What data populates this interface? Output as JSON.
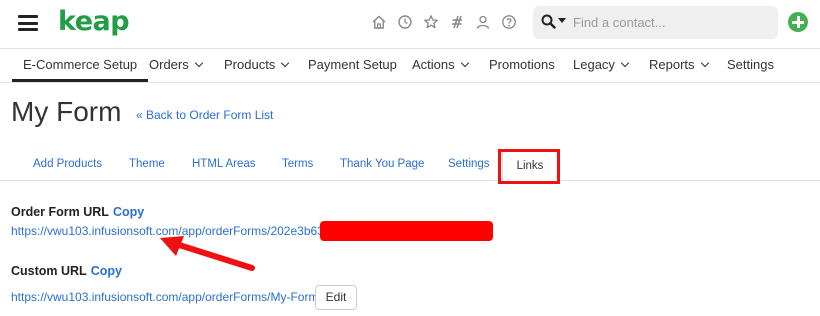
{
  "header": {
    "logo": "keap",
    "nav_icons": [
      "home-icon",
      "clock-icon",
      "star-icon",
      "hashtag-icon",
      "person-icon",
      "help-icon"
    ],
    "search_placeholder": "Find a contact..."
  },
  "menu": {
    "items": [
      {
        "label": "E-Commerce Setup",
        "active": true,
        "dropdown": false
      },
      {
        "label": "Orders",
        "dropdown": true
      },
      {
        "label": "Products",
        "dropdown": true
      },
      {
        "label": "Payment Setup",
        "dropdown": false
      },
      {
        "label": "Actions",
        "dropdown": true
      },
      {
        "label": "Promotions",
        "dropdown": false
      },
      {
        "label": "Legacy",
        "dropdown": true
      },
      {
        "label": "Reports",
        "dropdown": true
      },
      {
        "label": "Settings",
        "dropdown": false
      }
    ]
  },
  "page": {
    "title": "My Form",
    "back_link": "« Back to Order Form List"
  },
  "subtabs": [
    "Add Products",
    "Theme",
    "HTML Areas",
    "Terms",
    "Thank You Page",
    "Settings",
    "Links"
  ],
  "links": {
    "order_form_label": "Order Form URL",
    "order_form_copy": "Copy",
    "order_form_url": "https://vwu103.infusionsoft.com/app/orderForms/202e3b63",
    "custom_label": "Custom URL",
    "custom_copy": "Copy",
    "custom_url": "https://vwu103.infusionsoft.com/app/orderForms/My-Form",
    "edit_label": "Edit"
  },
  "colors": {
    "brand_green": "#1f9e45",
    "link_blue": "#2a6fd1",
    "annotation_red": "#ee1111"
  }
}
